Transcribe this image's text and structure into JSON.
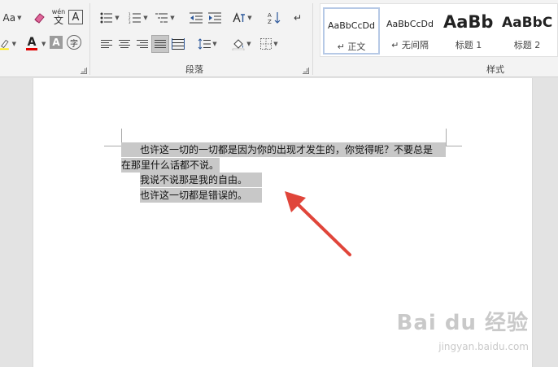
{
  "ribbon": {
    "font_group": {
      "change_case_label": "Aa",
      "phonetic_top": "wén",
      "phonetic_bottom": "文",
      "char_border_label": "A",
      "font_color_label": "A",
      "char_shading_label": "A",
      "enclose_char_label": "字",
      "font_color_hex": "#e00000"
    },
    "paragraph_group": {
      "label": "段落"
    },
    "styles_group": {
      "label": "样式",
      "items": [
        {
          "preview": "AaBbCcDd",
          "name": "↵ 正文",
          "selected": true
        },
        {
          "preview": "AaBbCcDd",
          "name": "↵ 无间隔",
          "selected": false
        },
        {
          "preview": "AaBb",
          "name": "标题 1",
          "selected": false
        },
        {
          "preview": "AaBbC",
          "name": "标题 2",
          "selected": false
        }
      ]
    }
  },
  "document": {
    "lines": [
      "也许这一切的一切都是因为你的出现才发生的，你觉得呢？不要总是",
      "在那里什么话都不说。",
      "我说不说那是我的自由。",
      "也许这一切都是错误的。"
    ]
  },
  "watermark": {
    "logo": "Bai du 经验",
    "url": "jingyan.baidu.com"
  },
  "colors": {
    "selection": "#c8c8c8",
    "arrow": "#e0453a",
    "selected_style_border": "#b6c9e6"
  }
}
